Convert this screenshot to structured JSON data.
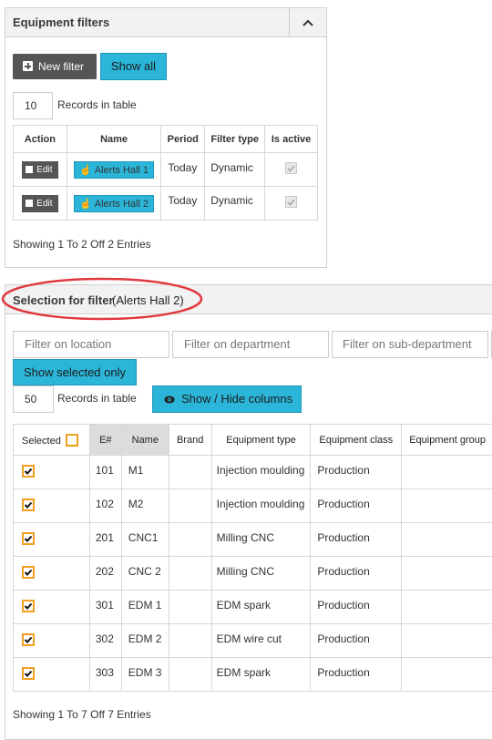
{
  "equipment_filters": {
    "title": "Equipment filters",
    "new_filter_label": "New filter",
    "show_all_label": "Show all",
    "records_value": "10",
    "records_label": "Records in table",
    "columns": [
      "Action",
      "Name",
      "Period",
      "Filter type",
      "Is active"
    ],
    "rows": [
      {
        "action": "Edit",
        "name": "Alerts Hall 1",
        "period": "Today",
        "filter_type": "Dynamic",
        "is_active": true
      },
      {
        "action": "Edit",
        "name": "Alerts Hall 2",
        "period": "Today",
        "filter_type": "Dynamic",
        "is_active": true
      }
    ],
    "footer": "Showing 1 To 2 Off 2 Entries"
  },
  "selection": {
    "title": "Selection for filter",
    "filter_name": "(Alerts Hall 2)",
    "filters": {
      "location_placeholder": "Filter on location",
      "department_placeholder": "Filter on department",
      "subdepartment_placeholder": "Filter on sub-department"
    },
    "show_selected_label": "Show selected only",
    "records_value": "50",
    "records_label": "Records in table",
    "show_hide_label": "Show / Hide columns",
    "columns": [
      "Selected",
      "E#",
      "Name",
      "Brand",
      "Equipment type",
      "Equipment class",
      "Equipment group"
    ],
    "rows": [
      {
        "selected": true,
        "e": "101",
        "name": "M1",
        "brand": "",
        "type": "Injection moulding",
        "class": "Production",
        "group": ""
      },
      {
        "selected": true,
        "e": "102",
        "name": "M2",
        "brand": "",
        "type": "Injection moulding",
        "class": "Production",
        "group": ""
      },
      {
        "selected": true,
        "e": "201",
        "name": "CNC1",
        "brand": "",
        "type": "Milling CNC",
        "class": "Production",
        "group": ""
      },
      {
        "selected": true,
        "e": "202",
        "name": "CNC 2",
        "brand": "",
        "type": "Milling CNC",
        "class": "Production",
        "group": ""
      },
      {
        "selected": true,
        "e": "301",
        "name": "EDM 1",
        "brand": "",
        "type": "EDM spark",
        "class": "Production",
        "group": ""
      },
      {
        "selected": true,
        "e": "302",
        "name": "EDM 2",
        "brand": "",
        "type": "EDM wire cut",
        "class": "Production",
        "group": ""
      },
      {
        "selected": true,
        "e": "303",
        "name": "EDM 3",
        "brand": "",
        "type": "EDM spark",
        "class": "Production",
        "group": ""
      }
    ],
    "footer": "Showing 1 To 7 Off 7 Entries"
  },
  "colors": {
    "accent": "#2bb5d8",
    "highlight_ellipse": "#e0393e",
    "checkbox_orange": "#f0a020"
  }
}
